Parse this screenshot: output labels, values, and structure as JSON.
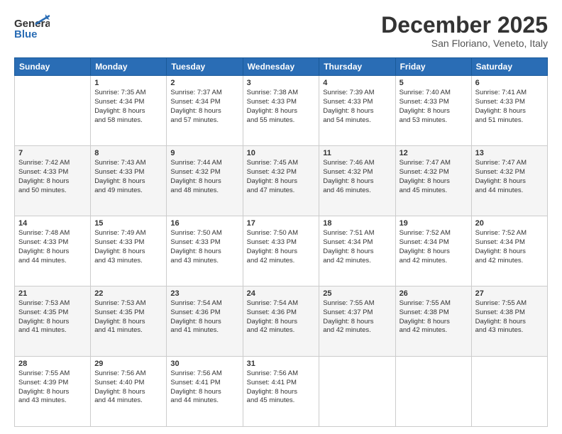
{
  "logo": {
    "general": "General",
    "blue": "Blue"
  },
  "title": "December 2025",
  "location": "San Floriano, Veneto, Italy",
  "weekdays": [
    "Sunday",
    "Monday",
    "Tuesday",
    "Wednesday",
    "Thursday",
    "Friday",
    "Saturday"
  ],
  "weeks": [
    [
      {
        "day": "",
        "sunrise": "",
        "sunset": "",
        "daylight": ""
      },
      {
        "day": "1",
        "sunrise": "Sunrise: 7:35 AM",
        "sunset": "Sunset: 4:34 PM",
        "daylight": "Daylight: 8 hours and 58 minutes."
      },
      {
        "day": "2",
        "sunrise": "Sunrise: 7:37 AM",
        "sunset": "Sunset: 4:34 PM",
        "daylight": "Daylight: 8 hours and 57 minutes."
      },
      {
        "day": "3",
        "sunrise": "Sunrise: 7:38 AM",
        "sunset": "Sunset: 4:33 PM",
        "daylight": "Daylight: 8 hours and 55 minutes."
      },
      {
        "day": "4",
        "sunrise": "Sunrise: 7:39 AM",
        "sunset": "Sunset: 4:33 PM",
        "daylight": "Daylight: 8 hours and 54 minutes."
      },
      {
        "day": "5",
        "sunrise": "Sunrise: 7:40 AM",
        "sunset": "Sunset: 4:33 PM",
        "daylight": "Daylight: 8 hours and 53 minutes."
      },
      {
        "day": "6",
        "sunrise": "Sunrise: 7:41 AM",
        "sunset": "Sunset: 4:33 PM",
        "daylight": "Daylight: 8 hours and 51 minutes."
      }
    ],
    [
      {
        "day": "7",
        "sunrise": "Sunrise: 7:42 AM",
        "sunset": "Sunset: 4:33 PM",
        "daylight": "Daylight: 8 hours and 50 minutes."
      },
      {
        "day": "8",
        "sunrise": "Sunrise: 7:43 AM",
        "sunset": "Sunset: 4:33 PM",
        "daylight": "Daylight: 8 hours and 49 minutes."
      },
      {
        "day": "9",
        "sunrise": "Sunrise: 7:44 AM",
        "sunset": "Sunset: 4:32 PM",
        "daylight": "Daylight: 8 hours and 48 minutes."
      },
      {
        "day": "10",
        "sunrise": "Sunrise: 7:45 AM",
        "sunset": "Sunset: 4:32 PM",
        "daylight": "Daylight: 8 hours and 47 minutes."
      },
      {
        "day": "11",
        "sunrise": "Sunrise: 7:46 AM",
        "sunset": "Sunset: 4:32 PM",
        "daylight": "Daylight: 8 hours and 46 minutes."
      },
      {
        "day": "12",
        "sunrise": "Sunrise: 7:47 AM",
        "sunset": "Sunset: 4:32 PM",
        "daylight": "Daylight: 8 hours and 45 minutes."
      },
      {
        "day": "13",
        "sunrise": "Sunrise: 7:47 AM",
        "sunset": "Sunset: 4:32 PM",
        "daylight": "Daylight: 8 hours and 44 minutes."
      }
    ],
    [
      {
        "day": "14",
        "sunrise": "Sunrise: 7:48 AM",
        "sunset": "Sunset: 4:33 PM",
        "daylight": "Daylight: 8 hours and 44 minutes."
      },
      {
        "day": "15",
        "sunrise": "Sunrise: 7:49 AM",
        "sunset": "Sunset: 4:33 PM",
        "daylight": "Daylight: 8 hours and 43 minutes."
      },
      {
        "day": "16",
        "sunrise": "Sunrise: 7:50 AM",
        "sunset": "Sunset: 4:33 PM",
        "daylight": "Daylight: 8 hours and 43 minutes."
      },
      {
        "day": "17",
        "sunrise": "Sunrise: 7:50 AM",
        "sunset": "Sunset: 4:33 PM",
        "daylight": "Daylight: 8 hours and 42 minutes."
      },
      {
        "day": "18",
        "sunrise": "Sunrise: 7:51 AM",
        "sunset": "Sunset: 4:34 PM",
        "daylight": "Daylight: 8 hours and 42 minutes."
      },
      {
        "day": "19",
        "sunrise": "Sunrise: 7:52 AM",
        "sunset": "Sunset: 4:34 PM",
        "daylight": "Daylight: 8 hours and 42 minutes."
      },
      {
        "day": "20",
        "sunrise": "Sunrise: 7:52 AM",
        "sunset": "Sunset: 4:34 PM",
        "daylight": "Daylight: 8 hours and 42 minutes."
      }
    ],
    [
      {
        "day": "21",
        "sunrise": "Sunrise: 7:53 AM",
        "sunset": "Sunset: 4:35 PM",
        "daylight": "Daylight: 8 hours and 41 minutes."
      },
      {
        "day": "22",
        "sunrise": "Sunrise: 7:53 AM",
        "sunset": "Sunset: 4:35 PM",
        "daylight": "Daylight: 8 hours and 41 minutes."
      },
      {
        "day": "23",
        "sunrise": "Sunrise: 7:54 AM",
        "sunset": "Sunset: 4:36 PM",
        "daylight": "Daylight: 8 hours and 41 minutes."
      },
      {
        "day": "24",
        "sunrise": "Sunrise: 7:54 AM",
        "sunset": "Sunset: 4:36 PM",
        "daylight": "Daylight: 8 hours and 42 minutes."
      },
      {
        "day": "25",
        "sunrise": "Sunrise: 7:55 AM",
        "sunset": "Sunset: 4:37 PM",
        "daylight": "Daylight: 8 hours and 42 minutes."
      },
      {
        "day": "26",
        "sunrise": "Sunrise: 7:55 AM",
        "sunset": "Sunset: 4:38 PM",
        "daylight": "Daylight: 8 hours and 42 minutes."
      },
      {
        "day": "27",
        "sunrise": "Sunrise: 7:55 AM",
        "sunset": "Sunset: 4:38 PM",
        "daylight": "Daylight: 8 hours and 43 minutes."
      }
    ],
    [
      {
        "day": "28",
        "sunrise": "Sunrise: 7:55 AM",
        "sunset": "Sunset: 4:39 PM",
        "daylight": "Daylight: 8 hours and 43 minutes."
      },
      {
        "day": "29",
        "sunrise": "Sunrise: 7:56 AM",
        "sunset": "Sunset: 4:40 PM",
        "daylight": "Daylight: 8 hours and 44 minutes."
      },
      {
        "day": "30",
        "sunrise": "Sunrise: 7:56 AM",
        "sunset": "Sunset: 4:41 PM",
        "daylight": "Daylight: 8 hours and 44 minutes."
      },
      {
        "day": "31",
        "sunrise": "Sunrise: 7:56 AM",
        "sunset": "Sunset: 4:41 PM",
        "daylight": "Daylight: 8 hours and 45 minutes."
      },
      {
        "day": "",
        "sunrise": "",
        "sunset": "",
        "daylight": ""
      },
      {
        "day": "",
        "sunrise": "",
        "sunset": "",
        "daylight": ""
      },
      {
        "day": "",
        "sunrise": "",
        "sunset": "",
        "daylight": ""
      }
    ]
  ]
}
